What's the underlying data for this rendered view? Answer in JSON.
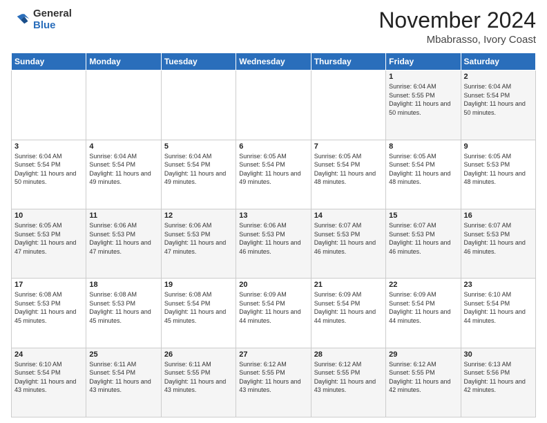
{
  "header": {
    "logo_general": "General",
    "logo_blue": "Blue",
    "month_title": "November 2024",
    "location": "Mbabrasso, Ivory Coast"
  },
  "days_of_week": [
    "Sunday",
    "Monday",
    "Tuesday",
    "Wednesday",
    "Thursday",
    "Friday",
    "Saturday"
  ],
  "weeks": [
    [
      {
        "day": "",
        "sunrise": "",
        "sunset": "",
        "daylight": ""
      },
      {
        "day": "",
        "sunrise": "",
        "sunset": "",
        "daylight": ""
      },
      {
        "day": "",
        "sunrise": "",
        "sunset": "",
        "daylight": ""
      },
      {
        "day": "",
        "sunrise": "",
        "sunset": "",
        "daylight": ""
      },
      {
        "day": "",
        "sunrise": "",
        "sunset": "",
        "daylight": ""
      },
      {
        "day": "1",
        "sunrise": "Sunrise: 6:04 AM",
        "sunset": "Sunset: 5:55 PM",
        "daylight": "Daylight: 11 hours and 50 minutes."
      },
      {
        "day": "2",
        "sunrise": "Sunrise: 6:04 AM",
        "sunset": "Sunset: 5:54 PM",
        "daylight": "Daylight: 11 hours and 50 minutes."
      }
    ],
    [
      {
        "day": "3",
        "sunrise": "Sunrise: 6:04 AM",
        "sunset": "Sunset: 5:54 PM",
        "daylight": "Daylight: 11 hours and 50 minutes."
      },
      {
        "day": "4",
        "sunrise": "Sunrise: 6:04 AM",
        "sunset": "Sunset: 5:54 PM",
        "daylight": "Daylight: 11 hours and 49 minutes."
      },
      {
        "day": "5",
        "sunrise": "Sunrise: 6:04 AM",
        "sunset": "Sunset: 5:54 PM",
        "daylight": "Daylight: 11 hours and 49 minutes."
      },
      {
        "day": "6",
        "sunrise": "Sunrise: 6:05 AM",
        "sunset": "Sunset: 5:54 PM",
        "daylight": "Daylight: 11 hours and 49 minutes."
      },
      {
        "day": "7",
        "sunrise": "Sunrise: 6:05 AM",
        "sunset": "Sunset: 5:54 PM",
        "daylight": "Daylight: 11 hours and 48 minutes."
      },
      {
        "day": "8",
        "sunrise": "Sunrise: 6:05 AM",
        "sunset": "Sunset: 5:54 PM",
        "daylight": "Daylight: 11 hours and 48 minutes."
      },
      {
        "day": "9",
        "sunrise": "Sunrise: 6:05 AM",
        "sunset": "Sunset: 5:53 PM",
        "daylight": "Daylight: 11 hours and 48 minutes."
      }
    ],
    [
      {
        "day": "10",
        "sunrise": "Sunrise: 6:05 AM",
        "sunset": "Sunset: 5:53 PM",
        "daylight": "Daylight: 11 hours and 47 minutes."
      },
      {
        "day": "11",
        "sunrise": "Sunrise: 6:06 AM",
        "sunset": "Sunset: 5:53 PM",
        "daylight": "Daylight: 11 hours and 47 minutes."
      },
      {
        "day": "12",
        "sunrise": "Sunrise: 6:06 AM",
        "sunset": "Sunset: 5:53 PM",
        "daylight": "Daylight: 11 hours and 47 minutes."
      },
      {
        "day": "13",
        "sunrise": "Sunrise: 6:06 AM",
        "sunset": "Sunset: 5:53 PM",
        "daylight": "Daylight: 11 hours and 46 minutes."
      },
      {
        "day": "14",
        "sunrise": "Sunrise: 6:07 AM",
        "sunset": "Sunset: 5:53 PM",
        "daylight": "Daylight: 11 hours and 46 minutes."
      },
      {
        "day": "15",
        "sunrise": "Sunrise: 6:07 AM",
        "sunset": "Sunset: 5:53 PM",
        "daylight": "Daylight: 11 hours and 46 minutes."
      },
      {
        "day": "16",
        "sunrise": "Sunrise: 6:07 AM",
        "sunset": "Sunset: 5:53 PM",
        "daylight": "Daylight: 11 hours and 46 minutes."
      }
    ],
    [
      {
        "day": "17",
        "sunrise": "Sunrise: 6:08 AM",
        "sunset": "Sunset: 5:53 PM",
        "daylight": "Daylight: 11 hours and 45 minutes."
      },
      {
        "day": "18",
        "sunrise": "Sunrise: 6:08 AM",
        "sunset": "Sunset: 5:53 PM",
        "daylight": "Daylight: 11 hours and 45 minutes."
      },
      {
        "day": "19",
        "sunrise": "Sunrise: 6:08 AM",
        "sunset": "Sunset: 5:54 PM",
        "daylight": "Daylight: 11 hours and 45 minutes."
      },
      {
        "day": "20",
        "sunrise": "Sunrise: 6:09 AM",
        "sunset": "Sunset: 5:54 PM",
        "daylight": "Daylight: 11 hours and 44 minutes."
      },
      {
        "day": "21",
        "sunrise": "Sunrise: 6:09 AM",
        "sunset": "Sunset: 5:54 PM",
        "daylight": "Daylight: 11 hours and 44 minutes."
      },
      {
        "day": "22",
        "sunrise": "Sunrise: 6:09 AM",
        "sunset": "Sunset: 5:54 PM",
        "daylight": "Daylight: 11 hours and 44 minutes."
      },
      {
        "day": "23",
        "sunrise": "Sunrise: 6:10 AM",
        "sunset": "Sunset: 5:54 PM",
        "daylight": "Daylight: 11 hours and 44 minutes."
      }
    ],
    [
      {
        "day": "24",
        "sunrise": "Sunrise: 6:10 AM",
        "sunset": "Sunset: 5:54 PM",
        "daylight": "Daylight: 11 hours and 43 minutes."
      },
      {
        "day": "25",
        "sunrise": "Sunrise: 6:11 AM",
        "sunset": "Sunset: 5:54 PM",
        "daylight": "Daylight: 11 hours and 43 minutes."
      },
      {
        "day": "26",
        "sunrise": "Sunrise: 6:11 AM",
        "sunset": "Sunset: 5:55 PM",
        "daylight": "Daylight: 11 hours and 43 minutes."
      },
      {
        "day": "27",
        "sunrise": "Sunrise: 6:12 AM",
        "sunset": "Sunset: 5:55 PM",
        "daylight": "Daylight: 11 hours and 43 minutes."
      },
      {
        "day": "28",
        "sunrise": "Sunrise: 6:12 AM",
        "sunset": "Sunset: 5:55 PM",
        "daylight": "Daylight: 11 hours and 43 minutes."
      },
      {
        "day": "29",
        "sunrise": "Sunrise: 6:12 AM",
        "sunset": "Sunset: 5:55 PM",
        "daylight": "Daylight: 11 hours and 42 minutes."
      },
      {
        "day": "30",
        "sunrise": "Sunrise: 6:13 AM",
        "sunset": "Sunset: 5:56 PM",
        "daylight": "Daylight: 11 hours and 42 minutes."
      }
    ]
  ]
}
